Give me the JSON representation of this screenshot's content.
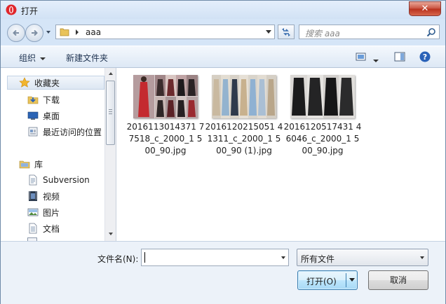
{
  "window": {
    "title": "打开",
    "close_glyph": "✕"
  },
  "navigation": {
    "back_icon": "back-arrow-icon",
    "forward_icon": "forward-arrow-icon",
    "address": {
      "segments": [
        "aaa"
      ]
    },
    "search": {
      "placeholder": "搜索 aaa"
    }
  },
  "toolbar": {
    "organize_label": "组织",
    "new_folder_label": "新建文件夹"
  },
  "sidebar": {
    "items": [
      {
        "label": "收藏夹",
        "icon": "star-icon"
      },
      {
        "label": "下载",
        "icon": "download-folder-icon"
      },
      {
        "label": "桌面",
        "icon": "desktop-icon"
      },
      {
        "label": "最近访问的位置",
        "icon": "recent-places-icon"
      },
      {
        "label": "库",
        "icon": "library-icon"
      },
      {
        "label": "Subversion",
        "icon": "document-library-icon"
      },
      {
        "label": "视频",
        "icon": "video-icon"
      },
      {
        "label": "图片",
        "icon": "picture-icon"
      },
      {
        "label": "文档",
        "icon": "document-icon"
      }
    ]
  },
  "files": [
    {
      "name": "2016113014371 77518_c_2000_1 500_90.jpg"
    },
    {
      "name": "2016120215051 41311_c_2000_1 500_90 (1).jpg"
    },
    {
      "name": "2016120517431 46046_c_2000_1 500_90.jpg"
    }
  ],
  "bottom": {
    "filename_label": "文件名(N):",
    "filename_value": "",
    "filetype_value": "所有文件",
    "open_label": "打开(O)",
    "cancel_label": "取消"
  },
  "colors": {
    "title_bar": "#d7e5f6",
    "close_button": "#c7503c",
    "selection": "#dde7f3",
    "open_button": "#bee6fd"
  }
}
